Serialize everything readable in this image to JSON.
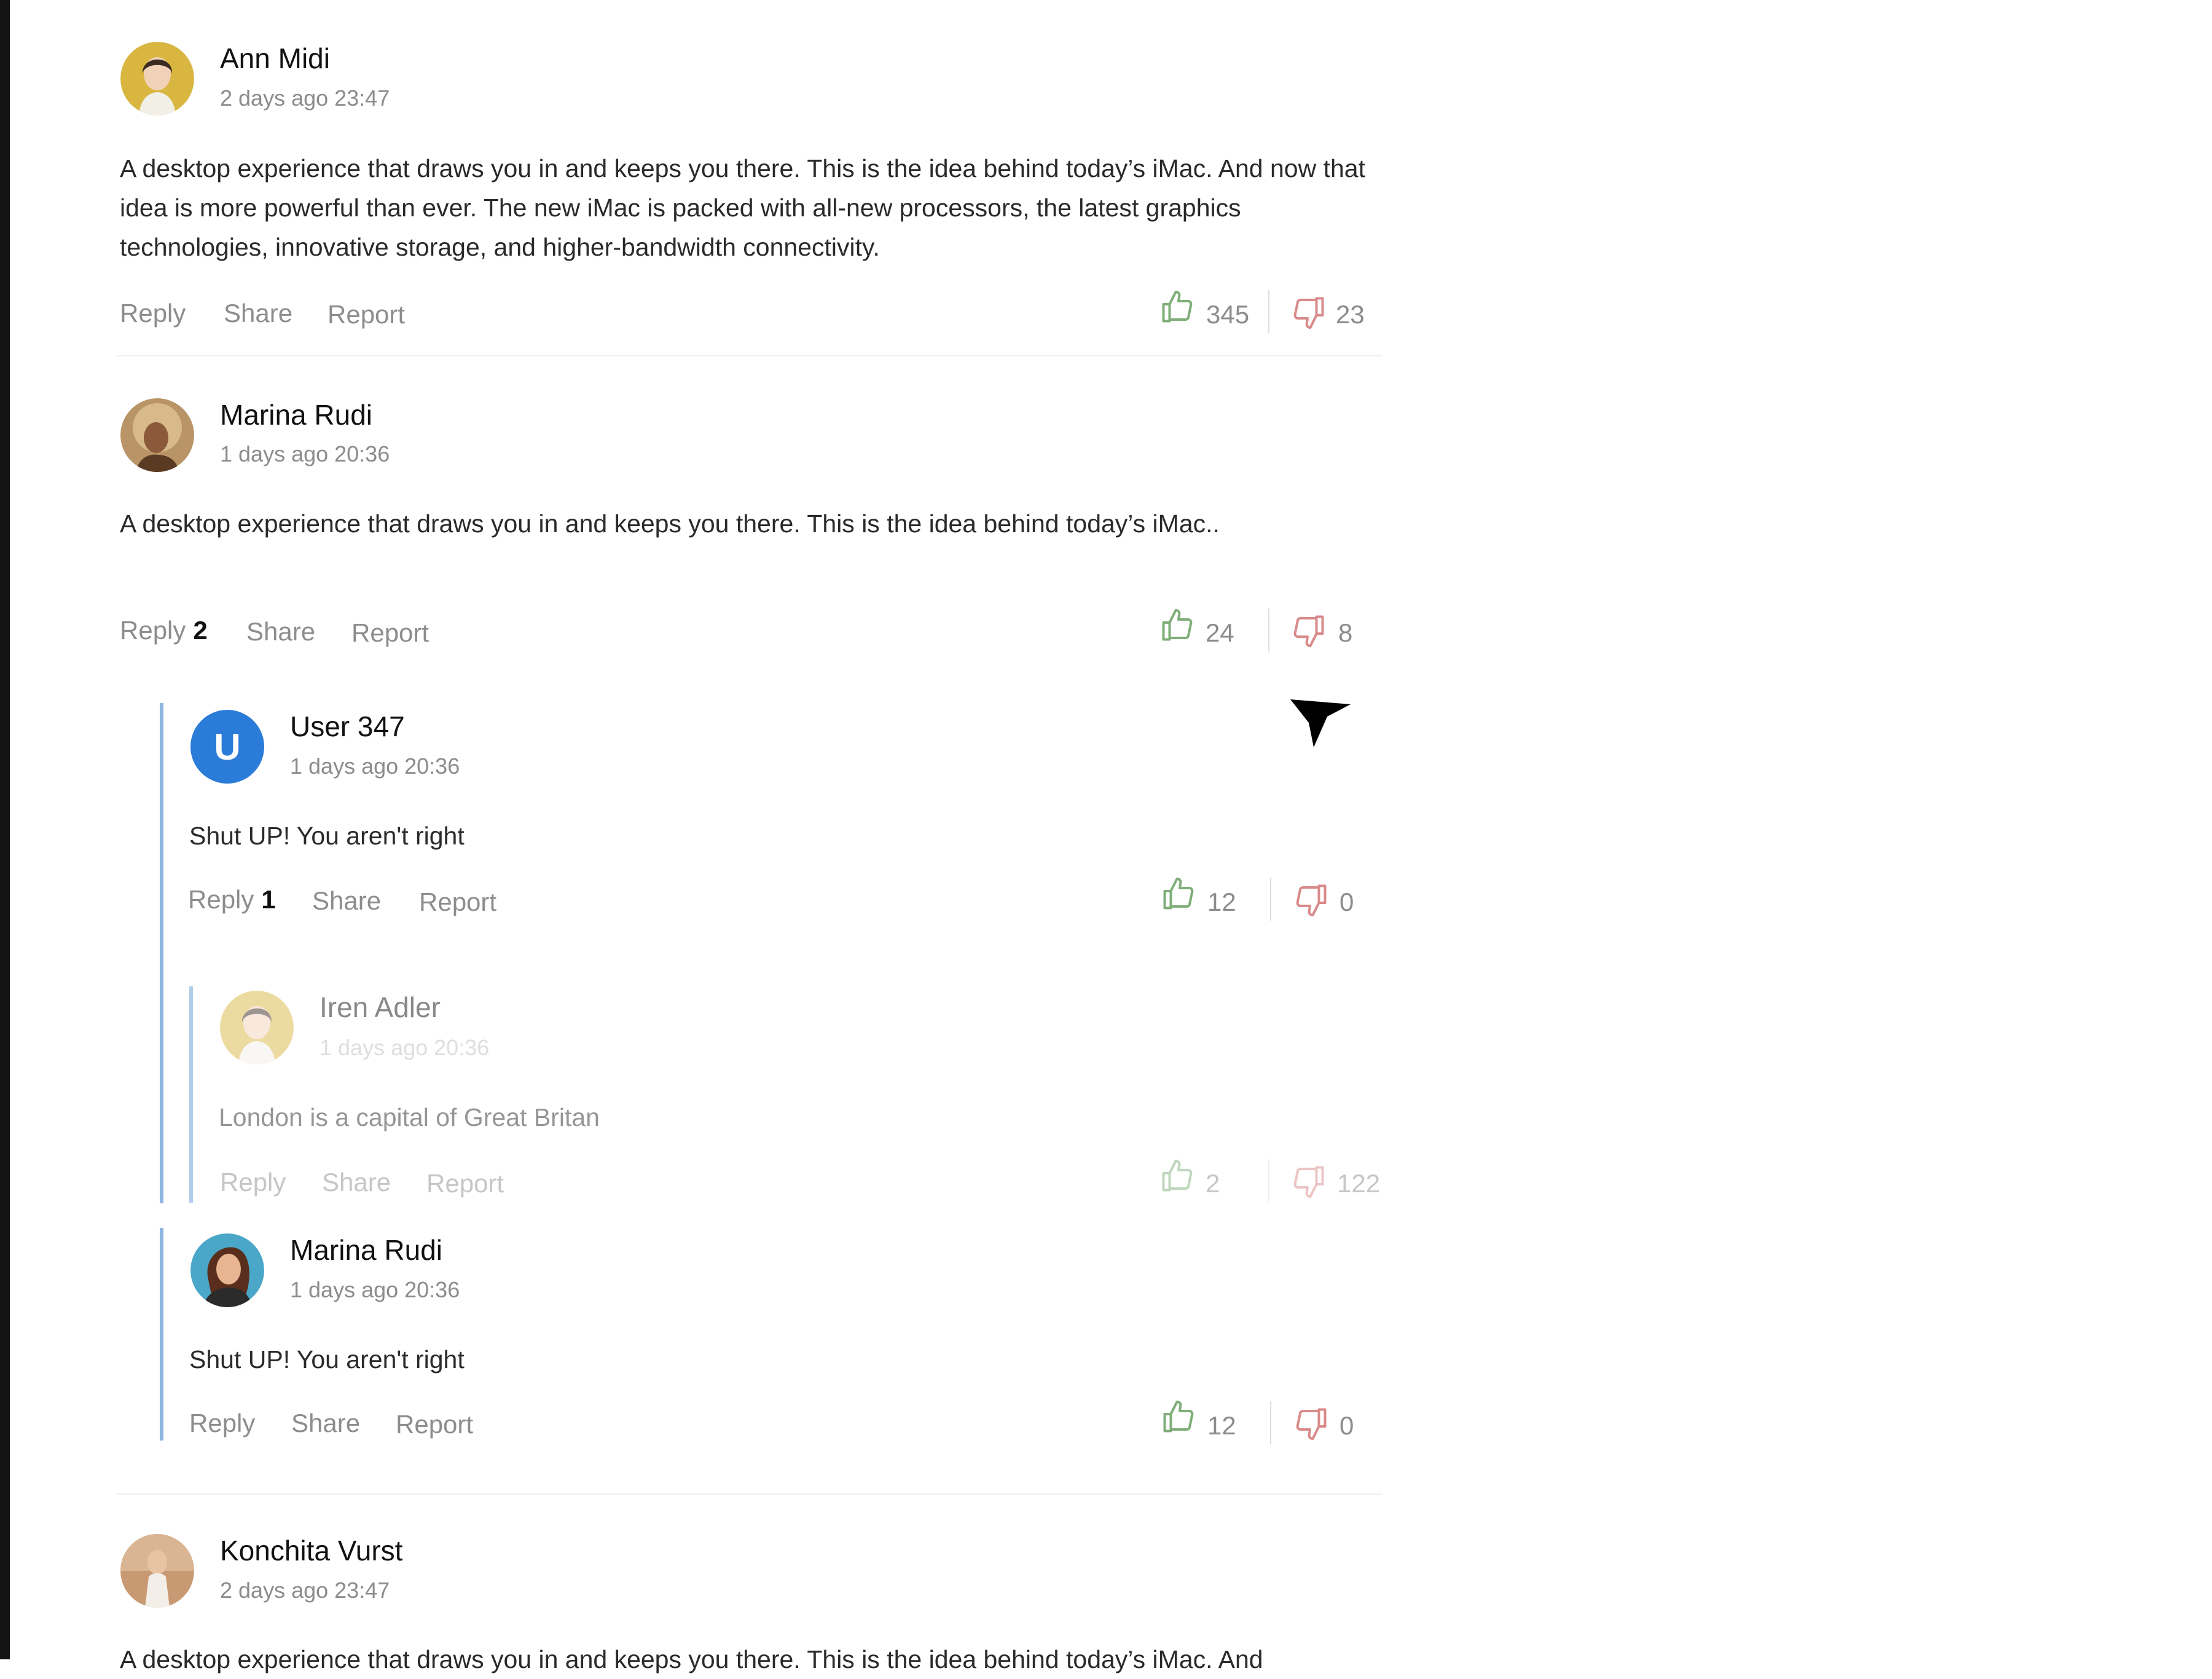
{
  "comments": [
    {
      "author": "Ann Midi",
      "time": "2 days ago 23:47",
      "text": "A desktop experience that draws you in and keeps you there. This is the idea behind today’s iMac. And now that idea is more powerful  than ever. The new iMac is packed with all-new processors, the latest graphics technologies, innovative storage, and higher-bandwidth connectivity.",
      "actions": {
        "reply": "Reply",
        "share": "Share",
        "report": "Report"
      },
      "likes": "345",
      "dislikes": "23"
    },
    {
      "author": "Marina Rudi",
      "time": "1 days ago 20:36",
      "text": "A desktop experience that draws you in and keeps you there. This is the idea behind today’s iMac..",
      "actions": {
        "reply": "Reply",
        "reply_count": "2",
        "share": "Share",
        "report": "Report"
      },
      "likes": "24",
      "dislikes": "8",
      "replies": [
        {
          "author": "User 347",
          "avatar_letter": "U",
          "time": "1 days ago 20:36",
          "text": "Shut UP! You aren't right",
          "actions": {
            "reply": "Reply",
            "reply_count": "1",
            "share": "Share",
            "report": "Report"
          },
          "likes": "12",
          "dislikes": "0",
          "replies": [
            {
              "author": "Iren Adler",
              "time": "1 days ago 20:36",
              "text": "London is a capital of Great Britan",
              "actions": {
                "reply": "Reply",
                "share": "Share",
                "report": "Report"
              },
              "likes": "2",
              "dislikes": "122"
            }
          ]
        },
        {
          "author": "Marina Rudi",
          "time": "1 days ago 20:36",
          "text": "Shut UP! You aren't right",
          "actions": {
            "reply": "Reply",
            "share": "Share",
            "report": "Report"
          },
          "likes": "12",
          "dislikes": "0"
        }
      ]
    },
    {
      "author": "Konchita Vurst",
      "time": "2 days ago 23:47",
      "text": "A desktop experience that draws you in and keeps you there. This is the idea behind today’s iMac. And"
    }
  ],
  "colors": {
    "like": "#7fae78",
    "dislike": "#d98a8a",
    "thread_line": "#8fb7e1",
    "avatar_letter_bg": "#2b7bd8"
  },
  "icons": {
    "like": "thumbs-up-icon",
    "dislike": "thumbs-down-icon",
    "send": "send-arrow-icon"
  }
}
